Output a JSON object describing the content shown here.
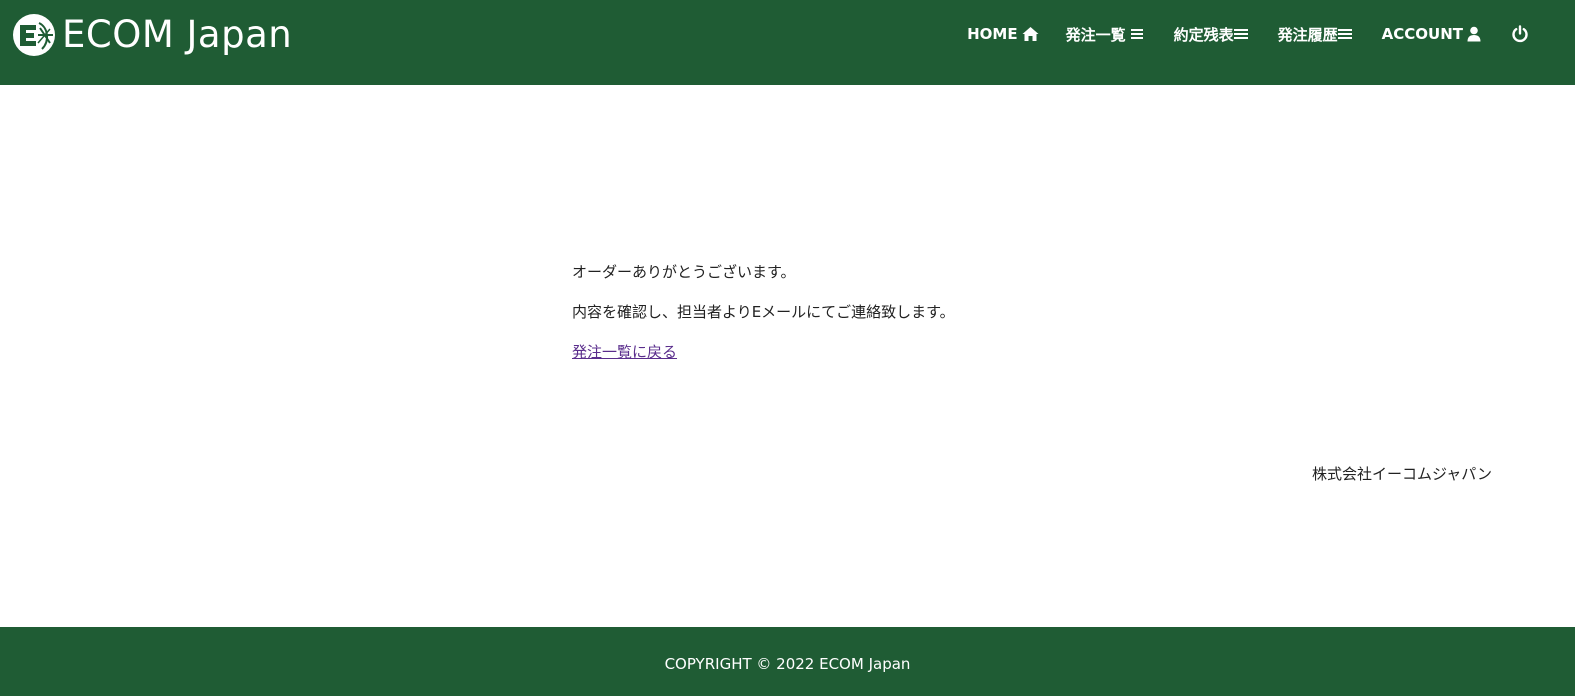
{
  "header": {
    "brand_name": "ECOM Japan",
    "nav": {
      "home": "HOME",
      "order_list": "発注一覧",
      "contract_balance": "約定残表",
      "order_history": "発注履歴",
      "account": "ACCOUNT"
    },
    "icons": {
      "home": "home-icon",
      "order_list": "list-icon",
      "contract_balance": "list-icon",
      "order_history": "list-icon",
      "account": "user-icon",
      "logout": "power-icon"
    }
  },
  "main": {
    "thanks_message": "オーダーありがとうございます。",
    "confirm_message": "内容を確認し、担当者よりEメールにてご連絡致します。",
    "back_link": "発注一覧に戻る"
  },
  "company_name": "株式会社イーコムジャパン",
  "footer": {
    "copyright": "COPYRIGHT © 2022 ECOM Japan"
  },
  "colors": {
    "header_bg": "#1f5c34",
    "footer_bg": "#1f5c34",
    "link": "#5a2d8c",
    "text": "#222222"
  }
}
